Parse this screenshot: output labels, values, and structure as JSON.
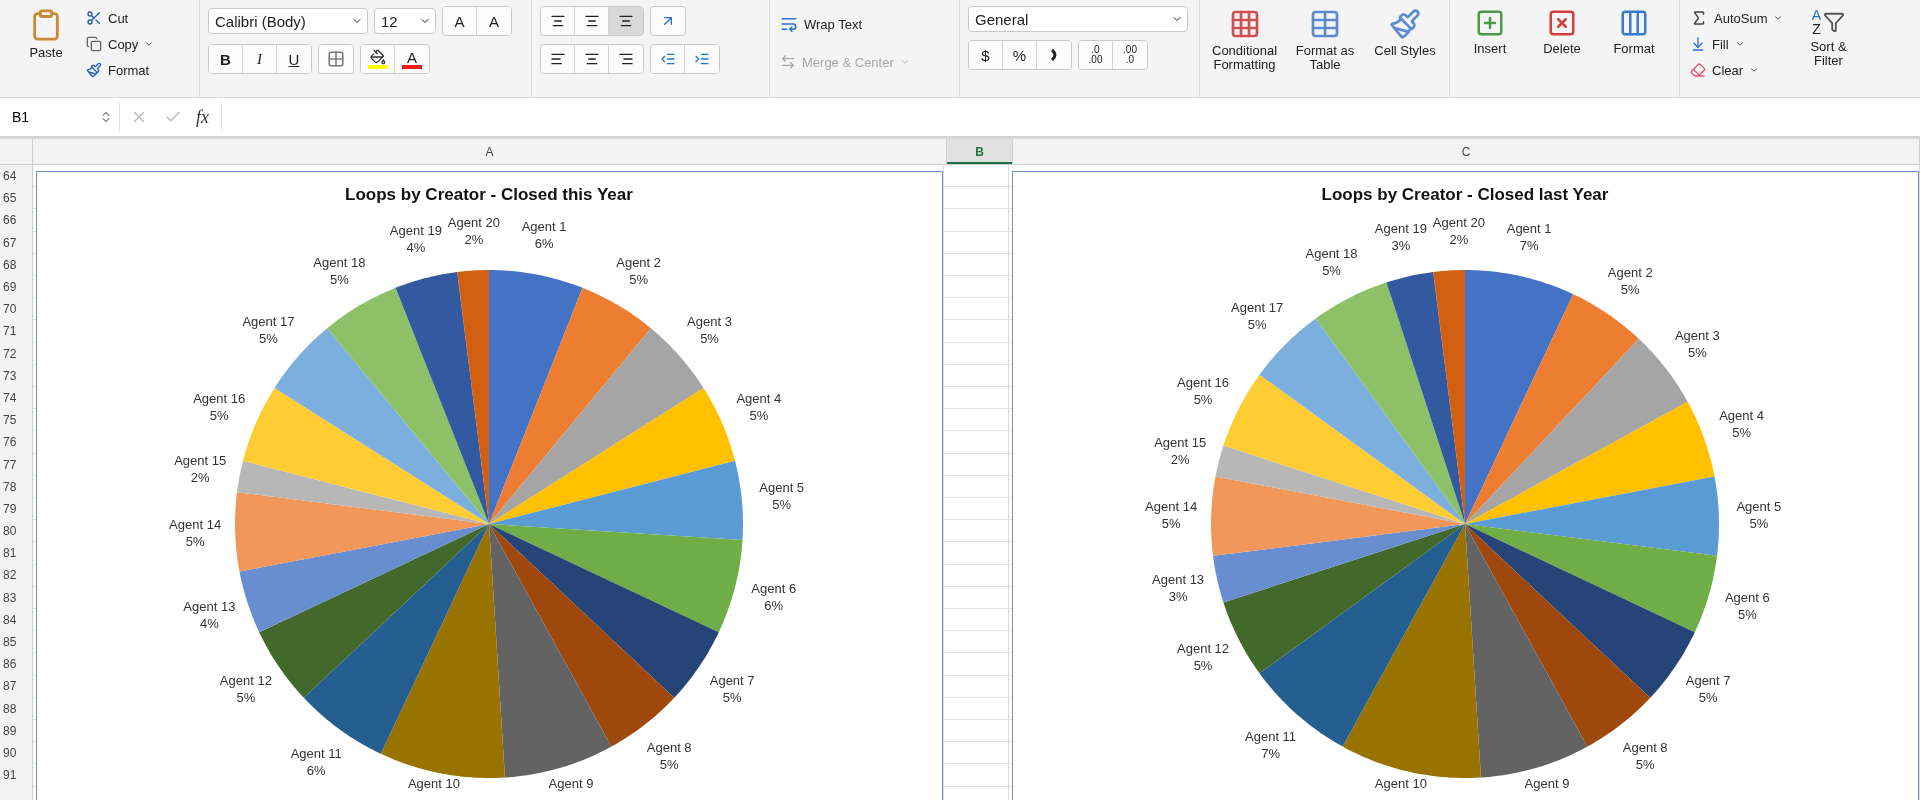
{
  "ribbon": {
    "clipboard": {
      "paste": "Paste",
      "cut": "Cut",
      "copy": "Copy",
      "format": "Format"
    },
    "font": {
      "name": "Calibri (Body)",
      "size": "12",
      "grow": "A",
      "shrink": "A",
      "bold": "B",
      "italic": "I",
      "underline": "U",
      "font_color": "A"
    },
    "alignment": {
      "wrap_text": "Wrap Text",
      "merge_center": {
        "label": "Merge & Center",
        "disabled": true
      }
    },
    "number": {
      "format": "General",
      "currency": "$",
      "percent": "%",
      "increase_decimal": [
        ".0",
        ".00"
      ],
      "decrease_decimal": [
        ".00",
        ".0"
      ]
    },
    "styles": [
      "Conditional Formatting",
      "Format as Table",
      "Cell Styles"
    ],
    "cells": [
      "Insert",
      "Delete",
      "Format"
    ],
    "editing": {
      "autosum": "AutoSum",
      "fill": "Fill",
      "clear": "Clear",
      "sort_filter": "Sort & Filter",
      "sort_letters": [
        "A",
        "Z"
      ]
    }
  },
  "formula_bar": {
    "name_box": "B1",
    "fx": "fx"
  },
  "columns": [
    {
      "label": "A",
      "selected": false
    },
    {
      "label": "B",
      "selected": true
    },
    {
      "label": "C",
      "selected": false
    }
  ],
  "rows": [
    "64",
    "65",
    "66",
    "67",
    "68",
    "69",
    "70",
    "71",
    "72",
    "73",
    "74",
    "75",
    "76",
    "77",
    "78",
    "79",
    "80",
    "81",
    "82",
    "83",
    "84",
    "85",
    "86",
    "87",
    "88",
    "89",
    "90",
    "91"
  ],
  "charts": [
    {
      "chart_data": {
        "type": "pie",
        "title": "Loops by Creator - Closed this Year",
        "categories": [
          "Agent 1",
          "Agent 2",
          "Agent 3",
          "Agent 4",
          "Agent 5",
          "Agent 6",
          "Agent 7",
          "Agent 8",
          "Agent 9",
          "Agent 10",
          "Agent 11",
          "Agent 12",
          "Agent 13",
          "Agent 14",
          "Agent 15",
          "Agent 16",
          "Agent 17",
          "Agent 18",
          "Agent 19",
          "Agent 20"
        ],
        "values": [
          6,
          5,
          5,
          5,
          5,
          6,
          5,
          5,
          7,
          8,
          6,
          5,
          4,
          5,
          2,
          5,
          5,
          5,
          4,
          2
        ],
        "value_labels": [
          "6%",
          "5%",
          "5%",
          "5%",
          "5%",
          "6%",
          "5%",
          "5%",
          null,
          null,
          "6%",
          "5%",
          "4%",
          "5%",
          "2%",
          "5%",
          "5%",
          "5%",
          "4%",
          "2%"
        ]
      }
    },
    {
      "chart_data": {
        "type": "pie",
        "title": "Loops by Creator - Closed last Year",
        "categories": [
          "Agent 1",
          "Agent 2",
          "Agent 3",
          "Agent 4",
          "Agent 5",
          "Agent 6",
          "Agent 7",
          "Agent 8",
          "Agent 9",
          "Agent 10",
          "Agent 11",
          "Agent 12",
          "Agent 13",
          "Agent 14",
          "Agent 15",
          "Agent 16",
          "Agent 17",
          "Agent 18",
          "Agent 19",
          "Agent 20"
        ],
        "values": [
          7,
          5,
          5,
          5,
          5,
          5,
          5,
          5,
          7,
          9,
          7,
          5,
          3,
          5,
          2,
          5,
          5,
          5,
          3,
          2
        ],
        "value_labels": [
          "7%",
          "5%",
          "5%",
          "5%",
          "5%",
          "5%",
          "5%",
          "5%",
          null,
          null,
          "7%",
          "5%",
          "3%",
          "5%",
          "2%",
          "5%",
          "5%",
          "5%",
          "3%",
          "2%"
        ]
      }
    }
  ]
}
